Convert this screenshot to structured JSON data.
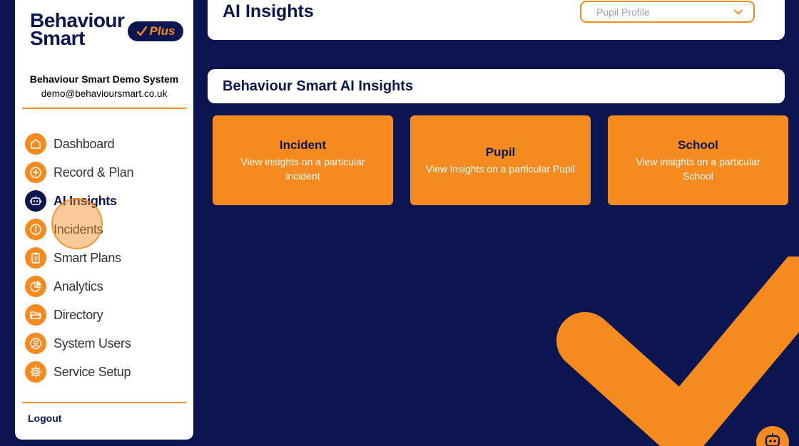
{
  "brand": {
    "logo_line1": "Behaviour",
    "logo_line2": "Smart",
    "plus_label": "Plus",
    "org_name": "Behaviour Smart Demo System",
    "org_email": "demo@behavioursmart.co.uk"
  },
  "sidebar": {
    "items": [
      {
        "label": "Dashboard",
        "icon": "home-icon"
      },
      {
        "label": "Record & Plan",
        "icon": "plus-circle-icon"
      },
      {
        "label": "AI Insights",
        "icon": "robot-icon",
        "active": true
      },
      {
        "label": "Incidents",
        "icon": "alert-icon"
      },
      {
        "label": "Smart Plans",
        "icon": "clipboard-icon"
      },
      {
        "label": "Analytics",
        "icon": "pie-chart-icon"
      },
      {
        "label": "Directory",
        "icon": "folder-icon"
      },
      {
        "label": "System Users",
        "icon": "user-icon"
      },
      {
        "label": "Service Setup",
        "icon": "gear-icon"
      }
    ],
    "logout_label": "Logout"
  },
  "header": {
    "title": "AI Insights",
    "profile_select_value": "Pupil Profile"
  },
  "section": {
    "title": "Behaviour Smart AI Insights"
  },
  "cards": [
    {
      "title": "Incident",
      "desc": "View insights on a particular incident"
    },
    {
      "title": "Pupil",
      "desc": "View insights on a particular Pupil"
    },
    {
      "title": "School",
      "desc": "View insights on a particular School"
    }
  ],
  "colors": {
    "background": "#0b1650",
    "accent": "#f58a1f",
    "panel": "#ffffff"
  }
}
